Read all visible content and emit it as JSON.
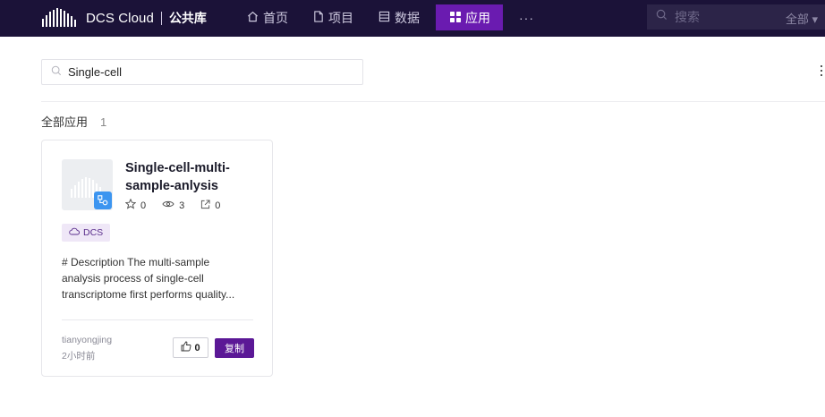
{
  "header": {
    "brand_name": "DCS Cloud",
    "brand_sub": "公共库",
    "nav": [
      {
        "label": "首页",
        "icon": "home-icon"
      },
      {
        "label": "项目",
        "icon": "file-icon"
      },
      {
        "label": "数据",
        "icon": "database-icon"
      },
      {
        "label": "应用",
        "icon": "apps-grid-icon",
        "active": true
      }
    ],
    "more_label": "···",
    "search_placeholder": "搜索",
    "search_scope": "全部"
  },
  "filter": {
    "value": "Single-cell"
  },
  "summary": {
    "label": "全部应用",
    "count": "1"
  },
  "apps": [
    {
      "title": "Single-cell-multi-sample-anlysis",
      "stars": "0",
      "views": "3",
      "shares": "0",
      "tag": "DCS",
      "description": [
        "# Description The multi-sample",
        "analysis process of single-cell",
        "transcriptome first performs quality..."
      ],
      "author": "tianyongjing",
      "time": "2小时前",
      "likes": "0",
      "copy_label": "复制"
    }
  ],
  "colors": {
    "topbar_bg": "#1b1238",
    "active_nav": "#6a1bb0",
    "primary_button": "#5b1896",
    "tag_bg": "#efe7f7",
    "badge_blue": "#3c95f0"
  }
}
